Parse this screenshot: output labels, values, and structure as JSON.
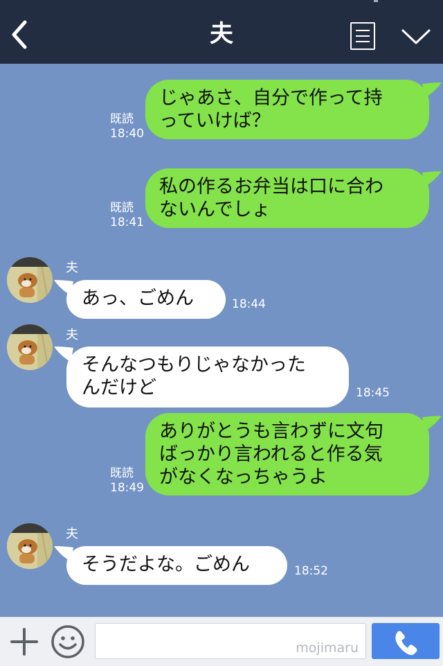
{
  "header": {
    "title": "夫",
    "back_icon": "chevron-left-icon",
    "menu_icon": "menu-list-icon",
    "dropdown_icon": "chevron-down-icon",
    "background": "#232d42"
  },
  "chat": {
    "background": "#7393c4",
    "my_bubble_color": "#84e24a",
    "their_bubble_color": "#ffffff",
    "messages": [
      {
        "from": "me",
        "lines": [
          "じゃあさ、自分で作って持",
          "っていけば？"
        ],
        "read": "既読",
        "time": "18:40"
      },
      {
        "from": "me",
        "lines": [
          "私の作るお弁当は口に合わ",
          "ないんでしょ"
        ],
        "read": "既読",
        "time": "18:41"
      },
      {
        "from": "them",
        "sender": "夫",
        "lines": [
          "あっ、ごめん"
        ],
        "time": "18:44"
      },
      {
        "from": "them",
        "sender": "夫",
        "lines": [
          "そんなつもりじゃなかった",
          "んだけど"
        ],
        "time": "18:45"
      },
      {
        "from": "me",
        "lines": [
          "ありがとうも言わずに文句",
          "ばっかり言われると作る気",
          "がなくなっちゃうよ"
        ],
        "read": "既読",
        "time": "18:49"
      },
      {
        "from": "them",
        "sender": "夫",
        "lines": [
          "そうだよな。ごめん"
        ],
        "time": "18:52"
      }
    ]
  },
  "footer": {
    "plus_icon": "plus-icon",
    "emoji_icon": "smiley-icon",
    "input_value": "",
    "watermark": "mojimaru",
    "call_icon": "phone-icon",
    "call_color": "#4a86e8"
  }
}
